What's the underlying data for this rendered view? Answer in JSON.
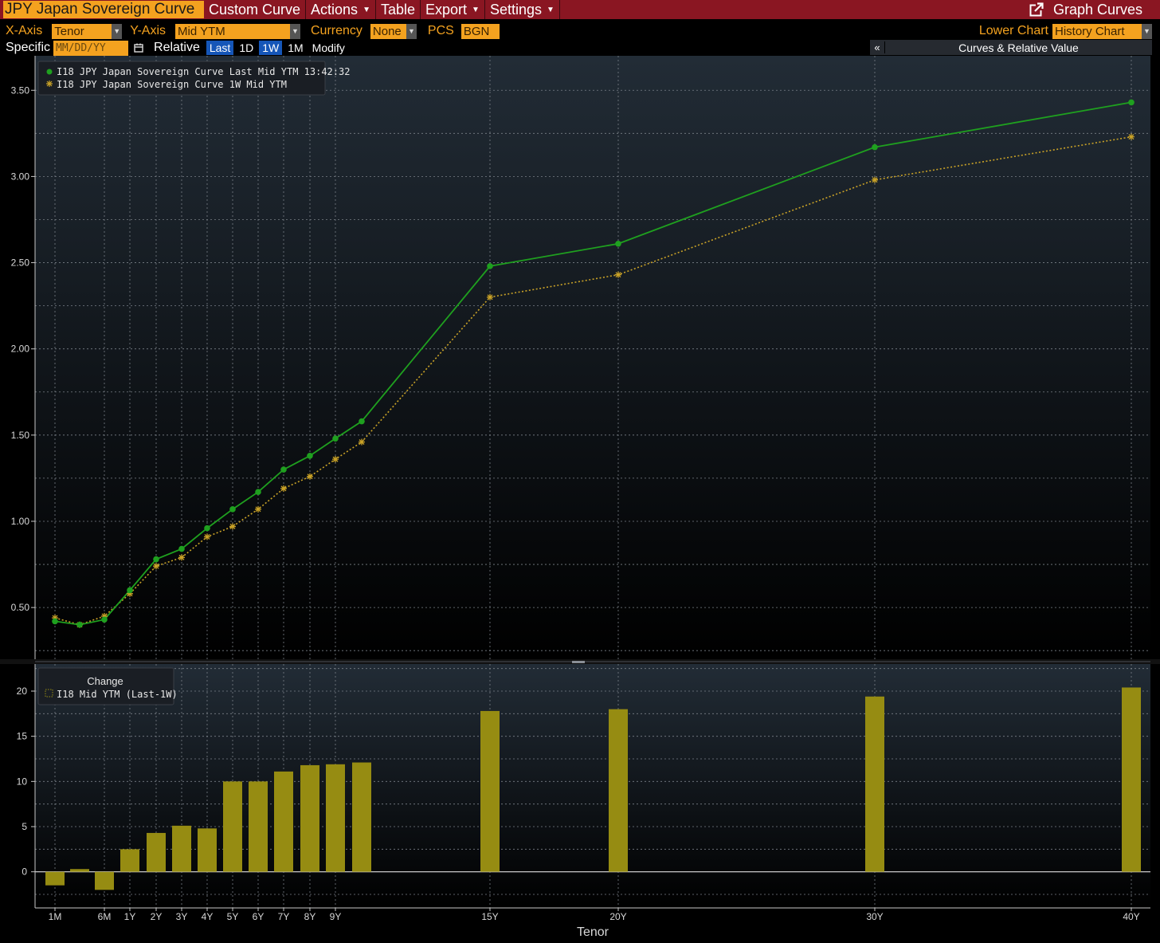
{
  "titlebar": {
    "security": "JPY Japan Sovereign Curve",
    "menu": [
      {
        "label": "Custom Curve",
        "dropdown": false
      },
      {
        "label": "Actions",
        "dropdown": true
      },
      {
        "label": "Table",
        "dropdown": false
      },
      {
        "label": "Export",
        "dropdown": true
      },
      {
        "label": "Settings",
        "dropdown": true
      }
    ],
    "right_label": "Graph Curves",
    "right_icon": "popout-icon"
  },
  "controls": {
    "xaxis_label": "X-Axis",
    "xaxis_value": "Tenor",
    "yaxis_label": "Y-Axis",
    "yaxis_value": "Mid YTM",
    "currency_label": "Currency",
    "currency_value": "None",
    "pcs_label": "PCS",
    "pcs_value": "BGN",
    "lower_chart_label": "Lower Chart",
    "lower_chart_value": "History Chart",
    "specific_label": "Specific",
    "date_placeholder": "MM/DD/YY",
    "relative_label": "Relative",
    "relative_buttons": [
      "Last",
      "1D",
      "1W",
      "1M"
    ],
    "active_buttons": [
      "Last",
      "1W"
    ],
    "modify_label": "Modify",
    "collapse_glyph": "«",
    "panel_title": "Curves & Relative Value"
  },
  "colors": {
    "background_top": "#222c36",
    "background_bottom": "#000000",
    "last_line": "#1fa01f",
    "week_line": "#c9a227",
    "bars": "#968c12",
    "titlebar": "#8a1622",
    "accent": "#f4a21f"
  },
  "chart_data": [
    {
      "type": "line",
      "title": "",
      "xlabel": "",
      "ylabel": "",
      "ylim": [
        0.2,
        3.7
      ],
      "y_ticks": [
        "0.50",
        "1.00",
        "1.50",
        "2.00",
        "2.50",
        "3.00",
        "3.50"
      ],
      "x_ticks": [
        "1M",
        "6M",
        "1Y",
        "2Y",
        "3Y",
        "4Y",
        "5Y",
        "6Y",
        "7Y",
        "8Y",
        "9Y",
        "15Y",
        "20Y",
        "30Y",
        "40Y"
      ],
      "grid": true,
      "legend": "top-left",
      "x_years": [
        0.0833,
        0.25,
        0.5,
        1,
        2,
        3,
        4,
        5,
        6,
        7,
        8,
        9,
        10,
        15,
        20,
        30,
        40
      ],
      "series": [
        {
          "name": "I18 JPY Japan Sovereign Curve Last Mid YTM 13:42:32",
          "marker": "dot",
          "values": [
            0.42,
            0.4,
            0.43,
            0.6,
            0.78,
            0.84,
            0.96,
            1.07,
            1.17,
            1.3,
            1.38,
            1.48,
            1.58,
            2.48,
            2.61,
            3.17,
            3.43
          ]
        },
        {
          "name": "I18 JPY Japan Sovereign Curve 1W Mid YTM",
          "marker": "star",
          "values": [
            0.44,
            0.4,
            0.45,
            0.58,
            0.74,
            0.79,
            0.91,
            0.97,
            1.07,
            1.19,
            1.26,
            1.36,
            1.46,
            2.3,
            2.43,
            2.98,
            3.23
          ]
        }
      ]
    },
    {
      "type": "bar",
      "title": "Change",
      "xlabel": "Tenor",
      "ylabel": "",
      "ylim": [
        -4,
        23
      ],
      "y_ticks": [
        "0",
        "5",
        "10",
        "15",
        "20"
      ],
      "grid": true,
      "legend": "top-left",
      "x_years": [
        0.0833,
        0.25,
        0.5,
        1,
        2,
        3,
        4,
        5,
        6,
        7,
        8,
        9,
        10,
        15,
        20,
        30,
        40
      ],
      "series": [
        {
          "name": "I18 Mid YTM (Last-1W)",
          "values": [
            -1.5,
            0.3,
            -2.0,
            2.5,
            4.3,
            5.1,
            4.8,
            10.0,
            10.0,
            11.1,
            11.8,
            11.9,
            12.1,
            17.8,
            18.0,
            19.4,
            20.4
          ]
        }
      ]
    }
  ]
}
